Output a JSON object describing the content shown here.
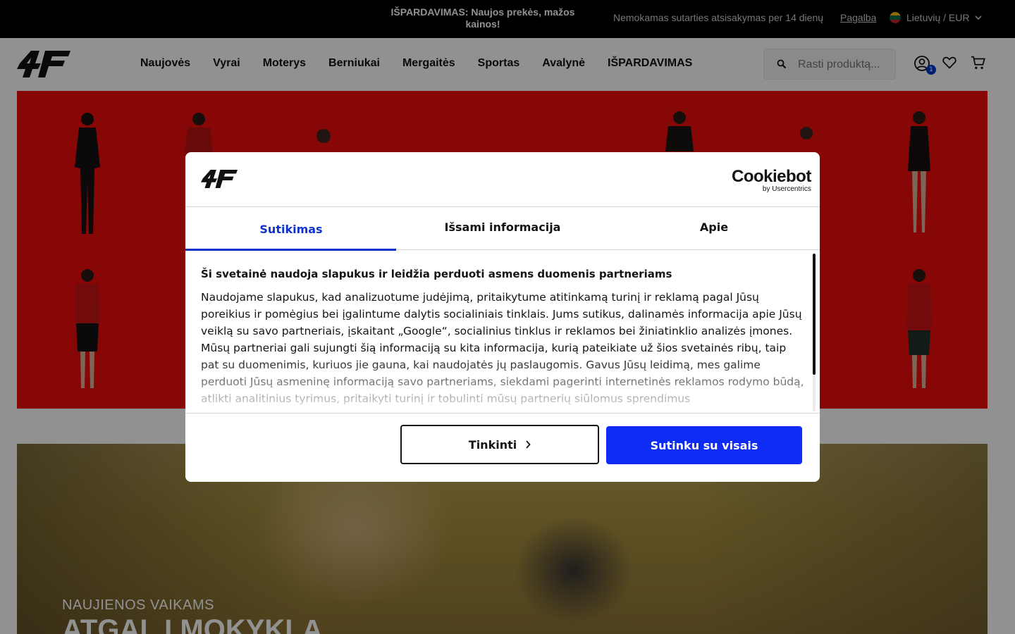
{
  "topbar": {
    "promo": "IŠPARDAVIMAS: Naujos prekės, mažos kainos!",
    "shipping": "Nemokamas sutarties atsisakymas per 14 dienų",
    "help": "Pagalba",
    "language": "Lietuvių / EUR",
    "flag_colors": [
      "#fdb913",
      "#006a44",
      "#c1272d"
    ]
  },
  "header": {
    "logo": "4F",
    "nav": [
      "Naujovės",
      "Vyrai",
      "Moterys",
      "Berniukai",
      "Mergaitės",
      "Sportas",
      "Avalynė",
      "IŠPARDAVIMAS"
    ],
    "search_placeholder": "Rasti produktą...",
    "account_badge": "1",
    "icons": [
      "search-icon",
      "account-icon",
      "heart-icon",
      "cart-icon"
    ]
  },
  "hero": {
    "background": "#ed0c0c"
  },
  "banner2": {
    "subtitle": "NAUJIENOS VAIKAMS",
    "title": "ATGAL Į MOKYKLĄ"
  },
  "cookie": {
    "brand": "Cookiebot",
    "brand_sub": "by Usercentrics",
    "tabs": [
      "Sutikimas",
      "Išsami informacija",
      "Apie"
    ],
    "active_tab": "Sutikimas",
    "heading": "Ši svetainė naudoja slapukus ir leidžia perduoti asmens duomenis partneriams",
    "body": "Naudojame slapukus, kad analizuotume judėjimą, pritaikytume atitinkamą turinį ir reklamą pagal Jūsų poreikius ir pomėgius bei įgalintume dalytis socialiniais tinklais. Jums sutikus, dalinamės informacija apie Jūsų veiklą su savo partneriais, įskaitant „Google“, socialinius tinklus ir reklamos bei žiniatinklio analizės įmones. Mūsų partneriai gali sujungti šią informaciją su kita informacija, kurią pateikiate už šios svetainės ribų, taip pat su duomenimis, kuriuos jie gauna, kai naudojatės jų paslaugomis. Gavus Jūsų leidimą, mes galime perduoti Jūsų asmeninę informaciją savo partneriams, siekdami pagerinti internetinės reklamos rodymo būdą, atlikti analitinius tyrimus, pritaikyti turinį ir tobulinti mūsų partnerių siūlomus sprendimus",
    "customize_button": "Tinkinti",
    "accept_button": "Sutinku su visais",
    "accent_color": "#0f2cf5"
  }
}
